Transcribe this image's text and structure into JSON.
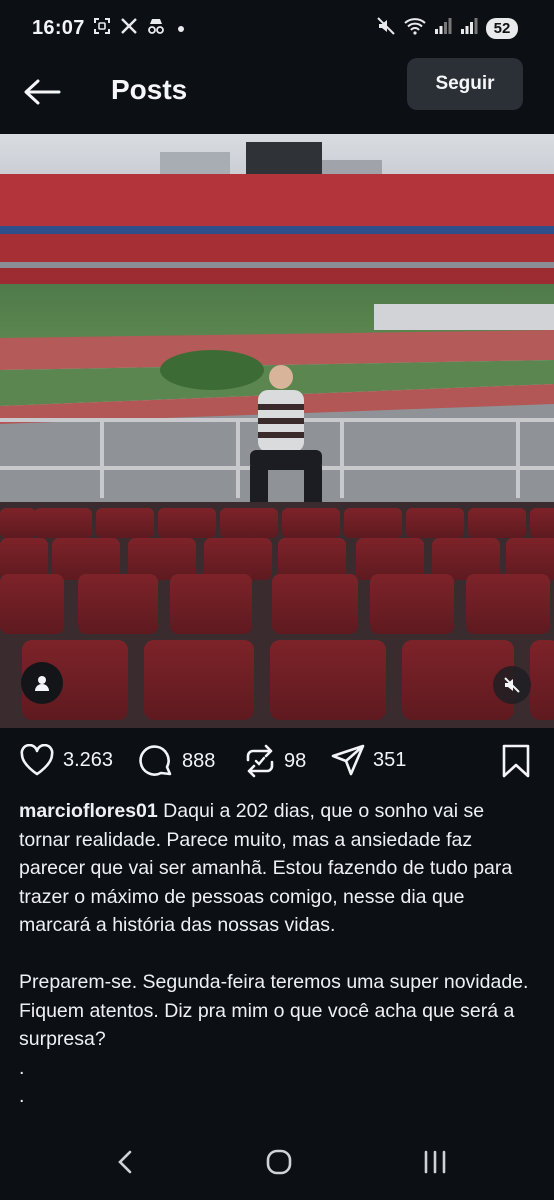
{
  "status_bar": {
    "time": "16:07",
    "left_icons": [
      "screenshot-icon",
      "x-logo-icon",
      "incognito-icon",
      "notification-dot"
    ],
    "right_icons": [
      "mute-icon",
      "wifi-icon",
      "signal-icon",
      "signal-icon"
    ],
    "battery": "52"
  },
  "header": {
    "back_icon": "arrow-left-icon",
    "title": "Posts",
    "follow_label": "Seguir"
  },
  "post": {
    "image_description_icons": [
      "user-tag-icon",
      "mute-icon"
    ],
    "likes": "3.263",
    "comments": "888",
    "reposts": "98",
    "shares": "351",
    "username": "marcioflores01",
    "caption": "Daqui a 202 dias, que o sonho vai se tornar realidade. Parece muito, mas a ansiedade faz parecer que vai ser amanhã. Estou fazendo de tudo para trazer o máximo de pessoas comigo, nesse dia que marcará a história das nossas vidas.\n\nPreparem-se. Segunda-feira teremos uma super novidade. Fiquem atentos. Diz pra mim o que você acha que será a surpresa?\n.\n."
  },
  "colors": {
    "background": "#0c0f14",
    "follow_button": "#2b2f36",
    "seat_red": "#8a2a2f",
    "text": "#f2f4f7"
  },
  "nav_bar": {
    "icons": [
      "back-chevron-icon",
      "home-circle-icon",
      "recents-icon"
    ]
  }
}
